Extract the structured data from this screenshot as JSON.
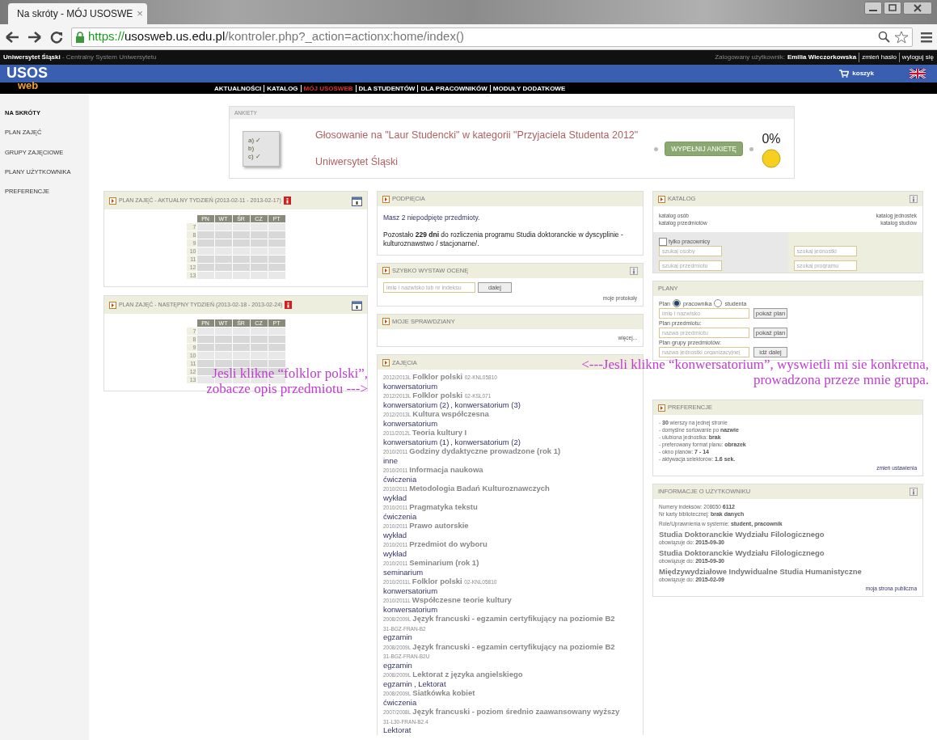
{
  "browser": {
    "tab_title": "Na skróty - MÓJ USOSWE",
    "tab_close": "×",
    "url_scheme": "https://",
    "url_host": "usosweb.us.edu.pl",
    "url_path": "/kontroler.php?_action=actionx:home/index()"
  },
  "top_strip": {
    "university": "Uniwersytet Śląski",
    "system": " - Centralny System Uniwersytetu",
    "login_label": "Zalogowany użytkownik:",
    "user_name": "Emilia Wieczorkowska",
    "links": [
      "zmień hasło",
      "wyloguj się"
    ]
  },
  "logo": {
    "main": "USOS",
    "sub": "web"
  },
  "cart": "koszyk",
  "menu": [
    {
      "label": "AKTUALNOŚCI",
      "selected": false
    },
    {
      "label": "KATALOG",
      "selected": false
    },
    {
      "label": "MÓJ USOSWEB",
      "selected": true
    },
    {
      "label": "DLA STUDENTÓW",
      "selected": false
    },
    {
      "label": "DLA PRACOWNIKÓW",
      "selected": false
    },
    {
      "label": "MODUŁY DODATKOWE",
      "selected": false
    }
  ],
  "sidebar": {
    "items": [
      {
        "label": "NA SKRÓTY",
        "selected": true
      },
      {
        "label": "PLAN ZAJĘĆ",
        "selected": false
      },
      {
        "label": "GRUPY ZAJĘCIOWE",
        "selected": false
      },
      {
        "label": "PLANY UŻYTKOWNIKA",
        "selected": false
      },
      {
        "label": "PREFERENCJE",
        "selected": false
      }
    ]
  },
  "ankiety": {
    "title": "ANKIETY",
    "checklist": [
      "a) ✓",
      "b)",
      "c) ✓"
    ],
    "survey": "Głosowanie na \"Laur Studencki\" w kategorii \"Przyjaciela Studenta 2012\"",
    "unit": "Uniwersytet Śląski",
    "button": "WYPEŁNIJ ANKIETĘ",
    "percent": "0%"
  },
  "plans": [
    {
      "title": "PLAN ZAJĘĆ - AKTUALNY TYDZIEŃ (2013-02-11 - 2013-02-17)",
      "days": [
        "PN",
        "WT",
        "ŚR",
        "CZ",
        "PT"
      ],
      "hours": [
        "7",
        "8",
        "9",
        "10",
        "11",
        "12",
        "13"
      ]
    },
    {
      "title": "PLAN ZAJĘĆ - NASTĘPNY TYDZIEŃ (2013-02-18 - 2013-02-24)",
      "days": [
        "PN",
        "WT",
        "ŚR",
        "CZ",
        "PT"
      ],
      "hours": [
        "7",
        "8",
        "9",
        "10",
        "11",
        "12",
        "13"
      ]
    }
  ],
  "podpiecia": {
    "title": "PODPIĘCIA",
    "link": "Masz 2 niepodpięte przedmioty.",
    "text": "Pozostało **229 dni** do rozliczenia programu Studia doktoranckie w dyscyplinie - kulturoznawstwo / stacjonarne/."
  },
  "ocena": {
    "title": "SZYBKO WYSTAW OCENĘ",
    "placeholder": "imię i nazwisko lub nr indeksu",
    "button": "dalej",
    "link": "moje protokoły"
  },
  "sprawdziany": {
    "title": "MOJE SPRAWDZIANY",
    "link": "więcej..."
  },
  "zajecia": {
    "title": "ZAJĘCIA",
    "group_separator": ", ",
    "items": [
      {
        "term": "2012/2013L",
        "name": "Folklor polski",
        "code": "02-KNL05810",
        "groups": [
          "konwersatorium"
        ]
      },
      {
        "term": "2012/2013L",
        "name": "Folklor polski",
        "code": "02-KSL071",
        "groups": [
          "konwersatorium (2)",
          "konwersatorium (3)"
        ]
      },
      {
        "term": "2012/2013L",
        "name": "Kultura współczesna",
        "groups": [
          "konwersatorium"
        ]
      },
      {
        "term": "2011/2012L",
        "name": "Teoria kultury I",
        "groups": [
          "konwersatorium (1)",
          "konwersatorium (2)"
        ]
      },
      {
        "term": "2010/2011",
        "name": "Godziny dydaktyczne prowadzone (rok 1)",
        "groups": [
          "inne"
        ]
      },
      {
        "term": "2010/2011",
        "name": "Informacja naukowa",
        "groups": [
          "ćwiczenia"
        ]
      },
      {
        "term": "2010/2011",
        "name": "Metodologia Badań Kulturoznawczych",
        "groups": [
          "wykład"
        ]
      },
      {
        "term": "2010/2011",
        "name": "Pragmatyka tekstu",
        "groups": [
          "ćwiczenia"
        ]
      },
      {
        "term": "2010/2011",
        "name": "Prawo autorskie",
        "groups": [
          "wykład"
        ]
      },
      {
        "term": "2010/2011",
        "name": "Przedmiot do wyboru",
        "groups": [
          "wykład"
        ]
      },
      {
        "term": "2010/2011",
        "name": "Seminarium (rok 1)",
        "groups": [
          "seminarium"
        ]
      },
      {
        "term": "2010/2011L",
        "name": "Folklor polski",
        "code": "02-KNL05810",
        "groups": [
          "konwersatorium"
        ]
      },
      {
        "term": "2010/2011L",
        "name": "Współczesne teorie kultury",
        "groups": [
          "konwersatorium"
        ]
      },
      {
        "term": "2008/2009L",
        "name": "Język francuski - egzamin certyfikujący na poziomie B2",
        "code": "31-BGZ-FRAN-B2",
        "groups": [
          "egzamin"
        ]
      },
      {
        "term": "2008/2009L",
        "name": "Język francuski - egzamin certyfikujący na poziomie B2",
        "code": "31-BGZ-FRAN-B2U",
        "groups": [
          "egzamin"
        ]
      },
      {
        "term": "2008/2009L",
        "name": "Lektorat z języka angielskiego",
        "groups": [
          "egzamin",
          "Lektorat"
        ]
      },
      {
        "term": "2008/2009L",
        "name": "Siatkówka kobiet",
        "groups": [
          "ćwiczenia"
        ]
      },
      {
        "term": "2007/2008L",
        "name": "Język francuski - poziom średnio zaawansowany wyższy",
        "code": "31-L30-FRAN-B2.4",
        "groups": [
          "Lektorat"
        ]
      }
    ]
  },
  "katalog": {
    "title": "KATALOG",
    "links_left": [
      "katalog osób",
      "katalog przedmiotów"
    ],
    "links_right": [
      "katalog jednostek",
      "katalog studiów"
    ],
    "checkbox": {
      "label": "tylko pracownicy",
      "checked": false
    },
    "placeholders": [
      "szukaj osoby",
      "szukaj jednostki",
      "szukaj przedmiotu",
      "szukaj programu"
    ]
  },
  "plany": {
    "title": "PLANY",
    "plan_label": "Plan",
    "radios": [
      {
        "label": "pracownika",
        "selected": true
      },
      {
        "label": "studenta",
        "selected": false
      }
    ],
    "rows": [
      {
        "label": null,
        "placeholder": "imię i nazwisko",
        "button": "pokaż plan"
      },
      {
        "label": "Plan przedmiotu:",
        "placeholder": "nazwa przedmiotu",
        "button": "pokaż plan"
      },
      {
        "label": "Plan grupy przedmiotów:",
        "placeholder": "nazwa jednostki organizacyjnej",
        "button": "idź dalej"
      }
    ]
  },
  "preferencje": {
    "title": "PREFERENCJE",
    "lines": [
      "- **30** wierszy na jednej stronie",
      "- domyślne sortowanie po **nazwie**",
      "- ulubiona jednostka: **brak**",
      "- preferowany format planu: **obrazek**",
      "- okno planów: **7 - 14**",
      "- aktywacja selektorów: **1.6 sek.**"
    ],
    "link": "zmień ustawienia"
  },
  "informacje": {
    "title": "INFORMACJE O UŻYTKOWNIKU",
    "lines": [
      "Numery indeksów: 208650 **6112**",
      "Nr karty bibliotecznej: **brak danych**"
    ],
    "roles": "Role/Uprawnienia w systemie: **student, pracownik**",
    "programs": [
      {
        "name": "Studia Doktoranckie Wydziału Filologicznego",
        "valid": "obowiązuje do: **2015-09-30**"
      },
      {
        "name": "Studia Doktoranckie Wydziału Filologicznego",
        "valid": "obowiązuje do: **2015-09-30**"
      },
      {
        "name": "Międzywydziałowe Indywidualne Studia Humanistyczne",
        "valid": "obowiązuje do: **2015-02-09**"
      }
    ],
    "link": "moja strona publiczna"
  },
  "annotations": [
    {
      "lines": [
        "Jesli klikne “folklor polski”,",
        "zobacze opis przedmiotu --->"
      ]
    },
    {
      "lines": [
        "<---Jesli klikne “konwersatorium”, wyswietli mi sie konkretna,",
        "prowadzona przeze mnie grupa."
      ]
    }
  ]
}
